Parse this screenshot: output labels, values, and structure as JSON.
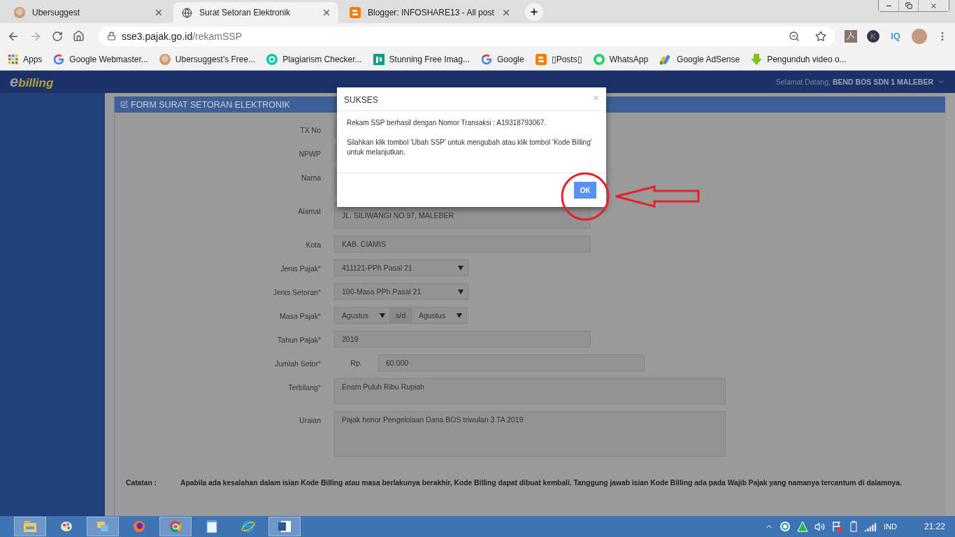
{
  "browser": {
    "tabs": [
      {
        "title": "Ubersuggest",
        "kind": "avatar",
        "selected": false
      },
      {
        "title": "Surat Setoran Elektronik",
        "kind": "globe",
        "selected": true
      },
      {
        "title": "Blogger: INFOSHARE13 - All post",
        "kind": "blogger",
        "selected": false
      }
    ],
    "url_host": "sse3.pajak.go.id",
    "url_path": "/rekamSSP",
    "extensions": [
      {
        "kind": "pdf"
      },
      {
        "kind": "badge",
        "label": "K"
      },
      {
        "kind": "text",
        "label": "IQ"
      }
    ],
    "bookmarks": [
      {
        "title": "Apps",
        "kind": "apps"
      },
      {
        "title": "Google Webmaster...",
        "kind": "google"
      },
      {
        "title": "Ubersuggest's Free...",
        "kind": "avatar"
      },
      {
        "title": "Plagiarism Checker...",
        "kind": "grammarly"
      },
      {
        "title": "Stunning Free Imag...",
        "kind": "px"
      },
      {
        "title": "Google",
        "kind": "google"
      },
      {
        "title": "▯Posts▯",
        "kind": "blogger"
      },
      {
        "title": "WhatsApp",
        "kind": "whatsapp"
      },
      {
        "title": "Google AdSense",
        "kind": "adsense"
      },
      {
        "title": "Pengunduh video o...",
        "kind": "download"
      }
    ]
  },
  "app": {
    "logo_mark": "e",
    "logo_text": "billing",
    "welcome": "Selamat Datang, **BEND BOS SDN 1 MALEBER**",
    "form_title": "FORM SURAT SETORAN ELEKTRONIK",
    "required_mark": "*",
    "fields": [
      {
        "label": "TX No",
        "kind": "text",
        "required": false
      },
      {
        "label": "NPWP",
        "kind": "text",
        "required": false
      },
      {
        "label": "Nama",
        "kind": "textarea",
        "required": false
      },
      {
        "label": "Alamat",
        "kind": "textarea",
        "required": false,
        "value": "JL. SILIWANGI NO.97, MALEBER"
      },
      {
        "label": "Kota",
        "kind": "text",
        "required": false,
        "value": "KAB. CIAMIS"
      },
      {
        "label": "Jenis Pajak",
        "kind": "select",
        "required": true,
        "value": "411121-PPh Pasal 21"
      },
      {
        "label": "Jenis Setoran",
        "kind": "select",
        "required": true,
        "value": "100-Masa PPh Pasal 21"
      },
      {
        "label": "Masa Pajak",
        "kind": "period",
        "required": true,
        "value": "Agustus",
        "separator": "s/d",
        "value_end": "Agustus"
      },
      {
        "label": "Tahun Pajak",
        "kind": "text",
        "required": true,
        "value": "2019"
      },
      {
        "label": "Jumlah Setor",
        "kind": "money",
        "required": true,
        "prefix": "Rp.",
        "value": "60.000"
      },
      {
        "label": "Terbilang",
        "kind": "wide",
        "required": true,
        "value": "Enam Puluh  Ribu  Rupiah"
      },
      {
        "label": "Uraian",
        "kind": "tall",
        "required": false,
        "value": "Pajak honor Pengelolaan Dana BOS triwulan 3 TA 2019"
      }
    ],
    "note_label": "Catatan :",
    "note": "Apabila ada kesalahan dalam isian Kode Billing atau masa berlakunya berakhir, Kode Billing dapat dibuat kembali. Tanggung jawab isian Kode Billing ada pada Wajib Pajak yang namanya tercantum di dalamnya."
  },
  "dialog": {
    "title": "SUKSES",
    "close": "×",
    "messages": [
      "Rekam SSP berhasil dengan Nomor Transaksi : A19318793067.",
      "Silahkan klik tombol 'Ubah SSP' untuk mengubah atau klik tombol 'Kode Billing' untuk melanjutkan."
    ],
    "button": "OK"
  },
  "taskbar": {
    "apps": [
      {
        "kind": "explorer",
        "running": true
      },
      {
        "kind": "paint",
        "running": false
      },
      {
        "kind": "windows",
        "running": true
      },
      {
        "kind": "firefox",
        "running": false
      },
      {
        "kind": "chrome",
        "running": true
      },
      {
        "kind": "notepad",
        "running": false
      },
      {
        "kind": "ie",
        "running": false
      },
      {
        "kind": "word",
        "running": true
      }
    ],
    "language": "IND",
    "time": "21:22"
  }
}
